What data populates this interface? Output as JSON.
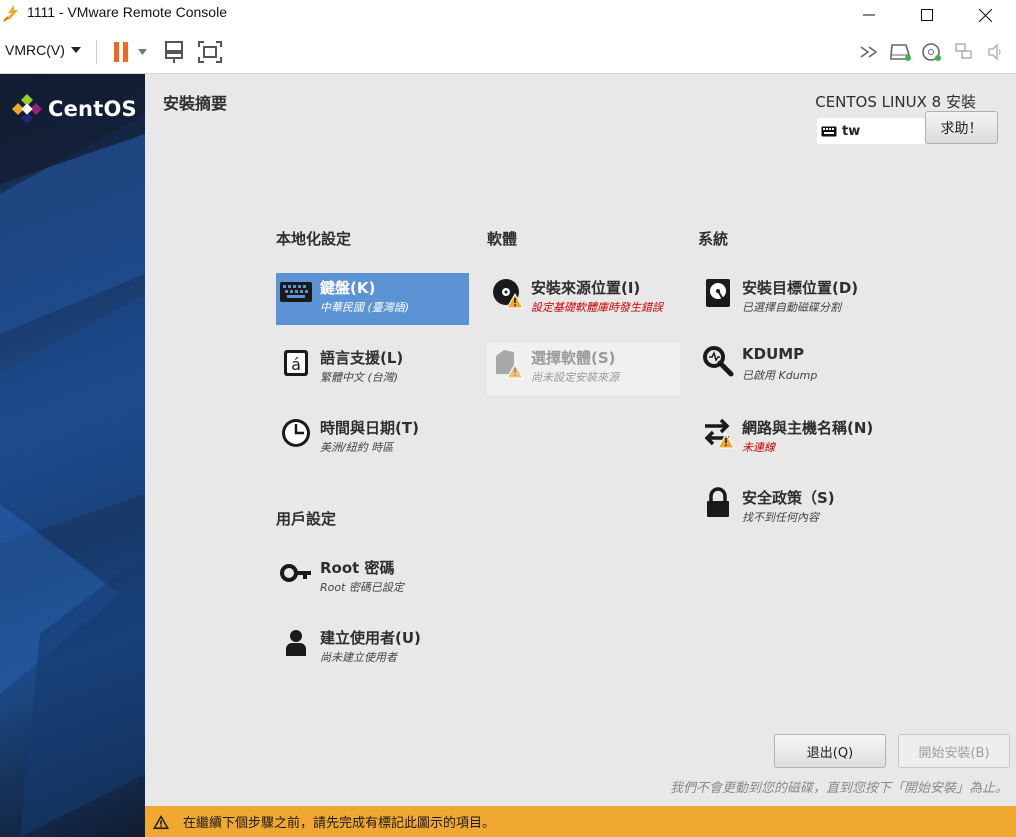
{
  "window": {
    "title": "1111 - VMware Remote Console",
    "icon": "vmware-icon",
    "controls": [
      "minimize-icon",
      "maximize-icon",
      "close-icon"
    ]
  },
  "toolbar": {
    "menu_label": "VMRC(V)",
    "items": [
      "pause-icon",
      "dropdown-arrow-icon",
      "send-ctrl-alt-del-icon",
      "fullscreen-icon"
    ],
    "right_icons": [
      "forward-icon",
      "hard-disk-icon",
      "cd-dvd-icon",
      "network-adapter-icon",
      "sound-icon"
    ]
  },
  "installer": {
    "brand": "CentOS",
    "hub_title": "安裝摘要",
    "product_title": "CENTOS LINUX 8 安裝",
    "keyboard_layout": "tw",
    "help_label": "求助！",
    "categories": {
      "localization": "本地化設定",
      "software": "軟體",
      "system": "系統",
      "user": "用戶設定"
    },
    "spokes": {
      "keyboard": {
        "label": "鍵盤(K)",
        "status": "中華民國 (臺灣語)"
      },
      "language": {
        "label": "語言支援(L)",
        "status": "繁體中文 (台灣)"
      },
      "time": {
        "label": "時間與日期(T)",
        "status": "美洲/紐約 時區"
      },
      "source": {
        "label": "安裝來源位置(I)",
        "status": "設定基礎軟體庫時發生錯誤"
      },
      "software": {
        "label": "選擇軟體(S)",
        "status": "尚未設定安裝來源"
      },
      "destination": {
        "label": "安裝目標位置(D)",
        "status": "已選擇自動磁碟分割"
      },
      "kdump": {
        "label": "KDUMP",
        "status": "已啟用 Kdump"
      },
      "network": {
        "label": "網路與主機名稱(N)",
        "status": "未連線"
      },
      "security": {
        "label": "安全政策（S)",
        "status": "找不到任何內容"
      },
      "root": {
        "label": "Root 密碼",
        "status": "Root 密碼已設定"
      },
      "user": {
        "label": "建立使用者(U)",
        "status": "尚未建立使用者"
      }
    },
    "quit_label": "退出(Q)",
    "begin_label": "開始安裝(B)",
    "footnote": "我們不會更動到您的磁碟，直到您按下「開始安裝」為止。",
    "warning": "在繼續下個步驟之前，請先完成有標記此圖示的項目。"
  },
  "colors": {
    "selected_spoke": "#5c93d4",
    "warning_bar": "#f0a830",
    "warning_text": "#cc0000",
    "console_bg": "#e8e8e8",
    "sidebar": "#1a3a6b"
  }
}
